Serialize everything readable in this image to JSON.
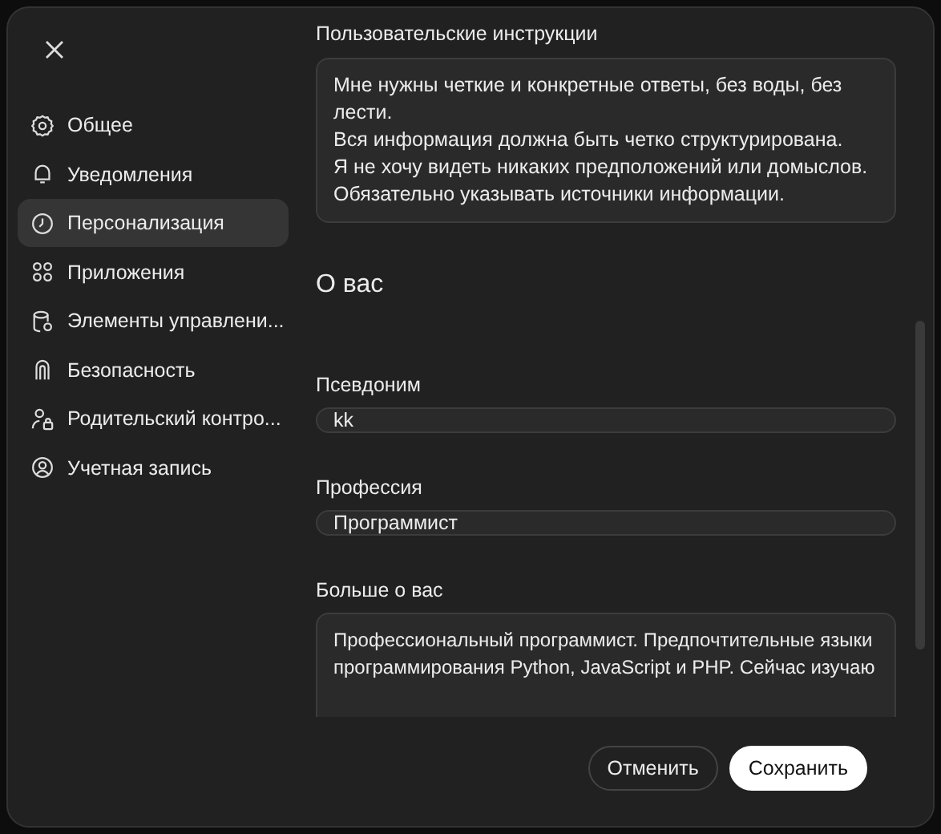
{
  "sidebar": {
    "items": [
      {
        "kind": "gear",
        "label": "Общее",
        "selected": false
      },
      {
        "kind": "bell",
        "label": "Уведомления",
        "selected": false
      },
      {
        "kind": "clock",
        "label": "Персонализация",
        "selected": true
      },
      {
        "kind": "apps",
        "label": "Приложения",
        "selected": false
      },
      {
        "kind": "data",
        "label": "Элементы управлени...",
        "selected": false
      },
      {
        "kind": "shield",
        "label": "Безопасность",
        "selected": false
      },
      {
        "kind": "parent",
        "label": "Родительский контро...",
        "selected": false
      },
      {
        "kind": "account",
        "label": "Учетная запись",
        "selected": false
      }
    ]
  },
  "instructions": {
    "label": "Пользовательские инструкции",
    "value": "Мне нужны четкие и конкретные ответы, без воды, без лести.\nВся информация должна быть четко структурирована.\nЯ не хочу видеть никаких предположений или домыслов.\nОбязательно указывать источники информации."
  },
  "about": {
    "heading": "О вас",
    "fields": [
      {
        "kind": "input",
        "label": "Псевдоним",
        "value": "kk"
      },
      {
        "kind": "input",
        "label": "Профессия",
        "value": "Программист"
      },
      {
        "kind": "textarea",
        "label": "Больше о вас",
        "value": "Профессиональный программист. Предпочтительные языки программирования Python, JavaScript и PHP. Сейчас изучаю"
      }
    ]
  },
  "buttons": [
    {
      "kind": "secondary",
      "label": "Отменить"
    },
    {
      "kind": "primary",
      "label": "Сохранить"
    }
  ]
}
